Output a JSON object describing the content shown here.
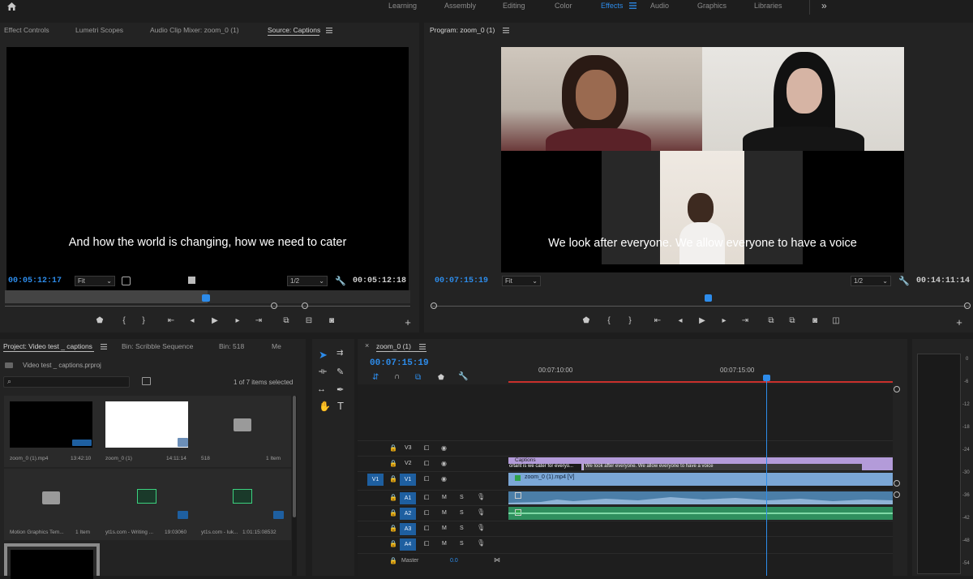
{
  "topbar": {
    "home_icon": "home-icon",
    "workspaces": [
      "Learning",
      "Assembly",
      "Editing",
      "Color",
      "Effects",
      "Audio",
      "Graphics",
      "Libraries"
    ],
    "active_workspace": "Effects",
    "overflow": "»"
  },
  "source_panel": {
    "tabs": [
      "Effect Controls",
      "Lumetri Scopes",
      "Audio Clip Mixer: zoom_0 (1)",
      "Source: Captions"
    ],
    "active_tab": "Source: Captions",
    "subtitle": "And how the world is changing, how we need to cater",
    "timecode": "00:05:12:17",
    "fit": "Fit",
    "resolution": "1/2",
    "duration": "00:05:12:18"
  },
  "program_panel": {
    "title": "Program: zoom_0 (1)",
    "subtitle": "We look after everyone. We allow everyone to have a voice",
    "timecode": "00:07:15:19",
    "fit": "Fit",
    "resolution": "1/2",
    "duration": "00:14:11:14"
  },
  "project_panel": {
    "tabs": [
      "Project: Video test _ captions",
      "Bin: Scribble Sequence",
      "Bin: 518",
      "Me"
    ],
    "file": "Video test _ captions.prproj",
    "selection": "1 of 7 items selected",
    "items": [
      {
        "name": "zoom_0 (1).mp4",
        "meta": "13:42:10",
        "kind": "black"
      },
      {
        "name": "zoom_0 (1)",
        "meta": "14:11:14",
        "kind": "white"
      },
      {
        "name": "518",
        "meta": "1 Item",
        "kind": "folder"
      },
      {
        "name": "Motion Graphics Tem...",
        "meta": "1 Item",
        "kind": "folder"
      },
      {
        "name": "yt1s.com - Writing ...",
        "meta": "19:03060",
        "kind": "audio"
      },
      {
        "name": "yt1s.com - luk...",
        "meta": "1:01:15:08532",
        "kind": "audio"
      }
    ]
  },
  "timeline": {
    "sequence": "zoom_0 (1)",
    "timecode": "00:07:15:19",
    "ruler": [
      "00:07:10:00",
      "00:07:15:00"
    ],
    "video_tracks": [
      {
        "label": "V3",
        "patch": ""
      },
      {
        "label": "V2",
        "patch": ""
      },
      {
        "label": "V1",
        "patch": "V1"
      }
    ],
    "audio_tracks": [
      {
        "label": "A1",
        "patch": "A1"
      },
      {
        "label": "A2",
        "patch": "A2"
      },
      {
        "label": "A3",
        "patch": "A3"
      },
      {
        "label": "A4",
        "patch": "A4"
      }
    ],
    "mute": "M",
    "solo": "S",
    "master_label": "Master",
    "master_value": "0.0",
    "captions_clip": "Captions",
    "caption_seg1": "ortant is we cater for everyo...",
    "caption_seg2": "We look after everyone. We allow everyone to have a voice",
    "video_clip": "zoom_0 (1).mp4 [V]",
    "playhead_fraction": 0.67
  },
  "meter": {
    "scale": [
      "0",
      "-6",
      "-12",
      "-18",
      "-24",
      "-30",
      "-36",
      "-42",
      "-48",
      "-54"
    ]
  },
  "colors": {
    "accent": "#2d8ceb",
    "video_clip": "#7ba7d6",
    "audio_clip": "#2f8f5e",
    "caption_clip": "#b39bd9",
    "ruler_red": "#c9302c"
  }
}
